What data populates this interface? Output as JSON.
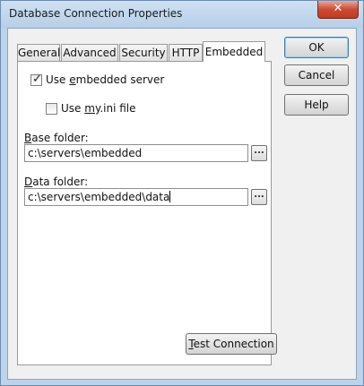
{
  "window": {
    "title": "Database Connection Properties",
    "close_glyph": "✕"
  },
  "tabs": [
    {
      "label": "General"
    },
    {
      "label": "Advanced"
    },
    {
      "label": "Security"
    },
    {
      "label": "HTTP"
    },
    {
      "label": "Embedded",
      "active": true
    }
  ],
  "embedded": {
    "use_embedded_server": {
      "pre": "Use ",
      "key": "e",
      "post": "mbedded server",
      "checked": true
    },
    "use_myini": {
      "pre": "Use ",
      "key": "m",
      "post": "y.ini file",
      "checked": false
    },
    "base_folder": {
      "key": "B",
      "label_rest": "ase folder:",
      "value": "c:\\servers\\embedded"
    },
    "data_folder": {
      "key": "D",
      "label_rest": "ata folder:",
      "value": "c:\\servers\\embedded\\data"
    },
    "browse_glyph": "...",
    "test_connection": {
      "key": "T",
      "rest": "est Connection"
    }
  },
  "buttons": {
    "ok": "OK",
    "cancel": "Cancel",
    "help": "Help"
  },
  "icons": {
    "checkbox": "checkbox-icon",
    "close": "close-icon",
    "browse": "ellipsis-icon"
  }
}
